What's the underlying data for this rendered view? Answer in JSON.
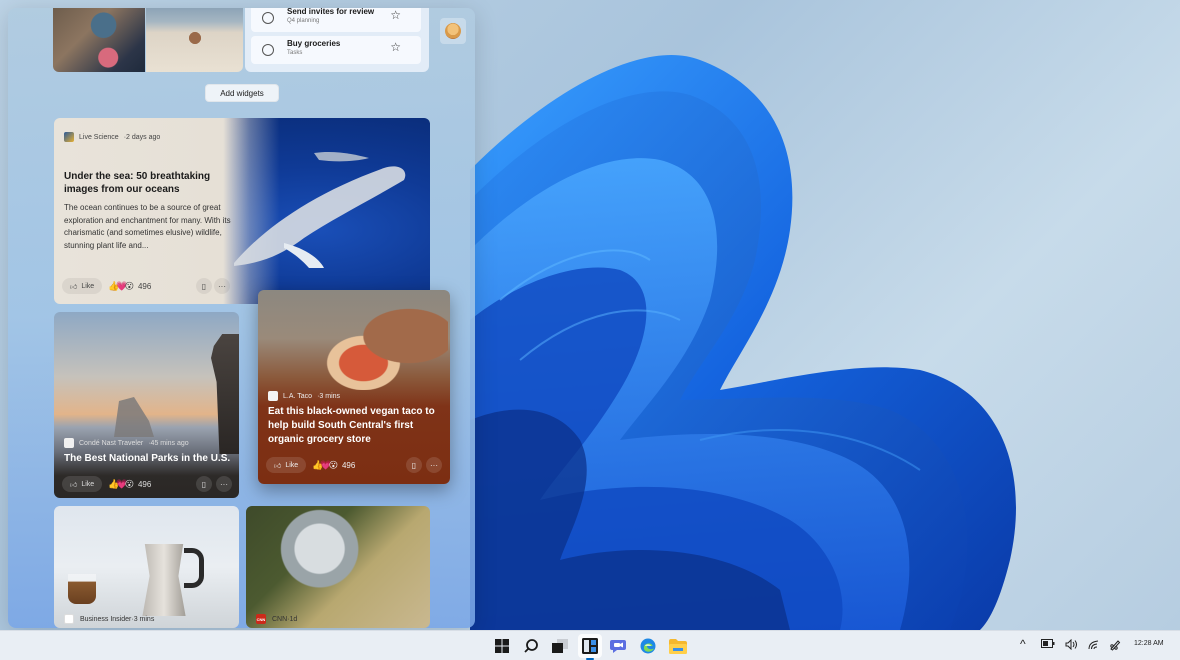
{
  "widgets": {
    "todo": {
      "items": [
        {
          "title": "Send invites for review",
          "list": "Q4 planning"
        },
        {
          "title": "Buy groceries",
          "list": "Tasks"
        }
      ],
      "star_icon": "☆"
    },
    "add_widgets_label": "Add widgets",
    "news": [
      {
        "source": "Live Science",
        "age": "2 days ago",
        "headline": "Under the sea: 50 breathtaking images from our oceans",
        "summary": "The ocean continues to be a source of great exploration and enchantment for many. With its charismatic (and sometimes elusive) wildlife, stunning plant life and...",
        "like_label": "Like",
        "reactions_emoji": "👍💗😮",
        "reactions_count": "496"
      },
      {
        "source": "Condé Nast Traveler",
        "age": "45 mins ago",
        "headline": "The Best National Parks in the U.S.",
        "like_label": "Like",
        "reactions_emoji": "👍💗😮",
        "reactions_count": "496"
      },
      {
        "source": "L.A. Taco",
        "age": "3 mins",
        "headline": "Eat this black-owned vegan taco to help build South Central's first organic grocery store",
        "like_label": "Like",
        "reactions_emoji": "👍💗😮",
        "reactions_count": "496"
      },
      {
        "source": "Business Insider",
        "age": "3 mins"
      },
      {
        "source": "CNN",
        "age": "1d",
        "logo_text": "CNN"
      }
    ],
    "separator": " · "
  },
  "taskbar": {
    "apps": [
      {
        "name": "Start",
        "icon": "windows-logo"
      },
      {
        "name": "Search",
        "icon": "search-icon"
      },
      {
        "name": "Task View",
        "icon": "task-view-icon"
      },
      {
        "name": "Widgets",
        "icon": "widgets-icon",
        "active": true
      },
      {
        "name": "Chat",
        "icon": "chat-icon"
      },
      {
        "name": "Edge",
        "icon": "edge-icon"
      },
      {
        "name": "File Explorer",
        "icon": "folder-icon"
      }
    ],
    "tray": {
      "chevron": "^",
      "time": "12:28 AM"
    }
  },
  "colors": {
    "accent": "#0067c0",
    "taco_card": "#7c2e12",
    "parks_card": "#2a2725",
    "cnn_red": "#cc2a1a"
  }
}
